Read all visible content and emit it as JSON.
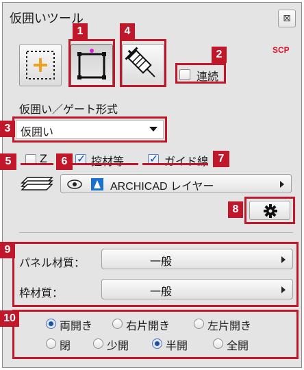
{
  "window": {
    "title": "仮囲いツール",
    "close_glyph": "⊠"
  },
  "callouts": [
    "1",
    "2",
    "3",
    "4",
    "5",
    "6",
    "7",
    "8",
    "9",
    "10"
  ],
  "tools": {
    "area_add_icon": "dashed-rectangle-plus-icon",
    "rectangle_icon": "rectangle-icon",
    "eyedropper_icon": "syringe-icon"
  },
  "continuous": {
    "label": "連続",
    "checked": false
  },
  "scp_label": "SCP",
  "format": {
    "label": "仮囲い／ゲート形式",
    "selected": "仮囲い"
  },
  "options": {
    "z": {
      "label": "Z",
      "checked": false
    },
    "materials": {
      "label": "控材等",
      "checked": true
    },
    "guide": {
      "label": "ガイド線",
      "checked": true
    }
  },
  "layer": {
    "name": "ARCHICAD レイヤー"
  },
  "panel_material": {
    "label": "パネル材質：",
    "value": "一般"
  },
  "frame_material": {
    "label": "枠材質：",
    "value": "一般"
  },
  "opening_type": {
    "options": [
      "両開き",
      "右片開き",
      "左片開き"
    ],
    "selected": "両開き"
  },
  "opening_state": {
    "options": [
      "閉",
      "少開",
      "半開",
      "全開"
    ],
    "selected": "半開"
  },
  "colors": {
    "callout_red": "#c0182a",
    "scp_red": "#e0102a",
    "accent_blue": "#1d4f9c"
  }
}
